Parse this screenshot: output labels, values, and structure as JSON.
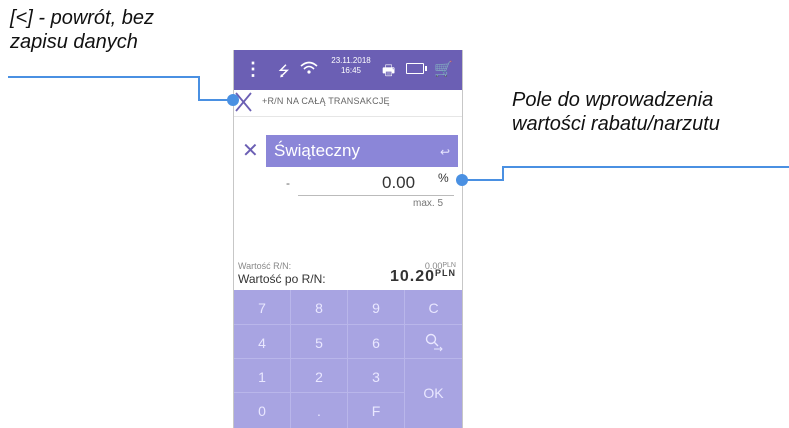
{
  "annotations": {
    "left_line1": "[<] - powrót, bez",
    "left_line2": "zapisu danych",
    "right_line1": "Pole do wprowadzenia",
    "right_line2": "wartości rabatu/narzutu"
  },
  "status_bar": {
    "date": "23.11.2018",
    "time": "16:45",
    "icons": [
      "menu-icon",
      "usb-icon",
      "wifi-icon",
      "printer-icon",
      "battery-icon",
      "cart-icon"
    ]
  },
  "header": {
    "title": "+R/N NA CAŁĄ TRANSAKCJĘ",
    "back_icon": "back-x-icon"
  },
  "discount": {
    "name": "Świąteczny",
    "sign": "-",
    "value": "0.00",
    "unit": "%",
    "max": "max. 5"
  },
  "summary": {
    "rn_label": "Wartość R/N:",
    "rn_value": "0.00",
    "rn_currency": "PLN",
    "after_label": "Wartość po R/N:",
    "after_value": "10.20",
    "after_currency": "PLN"
  },
  "keypad": {
    "keys": [
      "7",
      "8",
      "9",
      "C",
      "4",
      "5",
      "6",
      "",
      "1",
      "2",
      "3",
      "OK",
      "0",
      ".",
      "F"
    ]
  },
  "colors": {
    "status_bar": "#6b5fb4",
    "name_box": "#8b86d8",
    "keypad": "#a8a4e2",
    "leader_lines": "#4a90e2"
  }
}
